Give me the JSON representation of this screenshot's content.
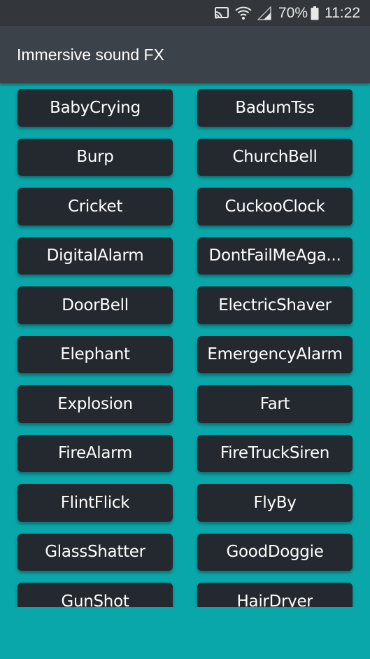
{
  "status_bar": {
    "battery": "70%",
    "time": "11:22",
    "icons": [
      "cast-icon",
      "wifi-icon",
      "signal-icon",
      "battery-icon"
    ]
  },
  "app_bar": {
    "title": "Immersive sound FX"
  },
  "sounds": [
    "BabyCrying",
    "BadumTss",
    "Burp",
    "ChurchBell",
    "Cricket",
    "CuckooClock",
    "DigitalAlarm",
    "DontFailMeAga...",
    "DoorBell",
    "ElectricShaver",
    "Elephant",
    "EmergencyAlarm",
    "Explosion",
    "Fart",
    "FireAlarm",
    "FireTruckSiren",
    "FlintFlick",
    "FlyBy",
    "GlassShatter",
    "GoodDoggie",
    "GunShot",
    "HairDryer"
  ],
  "colors": {
    "background": "#0aa7aa",
    "status_bar": "#33373c",
    "app_bar": "#3c4249",
    "button": "#23292f",
    "text": "#ffffff"
  }
}
